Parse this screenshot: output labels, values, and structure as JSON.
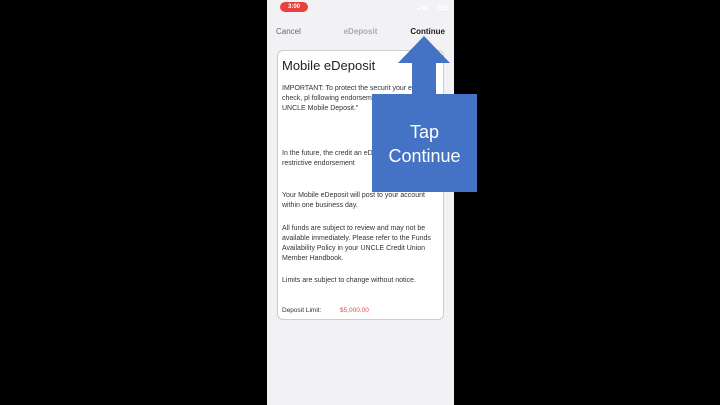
{
  "status": {
    "time": "3:00"
  },
  "nav": {
    "cancel": "Cancel",
    "title": "eDeposit",
    "continue": "Continue"
  },
  "card": {
    "title": "Mobile eDeposit",
    "important": "IMPORTANT: To protect the securit your eDeposit check, pl following endorsement your check \"For UNCLE Mobile Deposit.\"",
    "future": "In the future, the credit an eDeposit that does n restrictive endorsement",
    "post": "Your Mobile eDeposit will post to your account within one business day.",
    "funds": "All funds are subject to review and may not be available immediately. Please refer to the Funds Availability Policy in your UNCLE Credit Union Member Handbook.",
    "limits": "Limits are subject to change without notice.",
    "deposit_label": "Deposit Limit:",
    "deposit_value": "$5,000.00"
  },
  "overlay": {
    "line1": "Tap",
    "line2": "Continue"
  },
  "icons": {
    "signal": "signal-icon",
    "wifi": "wifi-icon",
    "battery": "battery-icon"
  },
  "colors": {
    "accent": "#4472c4",
    "time_pill": "#e8413b",
    "limit": "#e84a4a"
  }
}
